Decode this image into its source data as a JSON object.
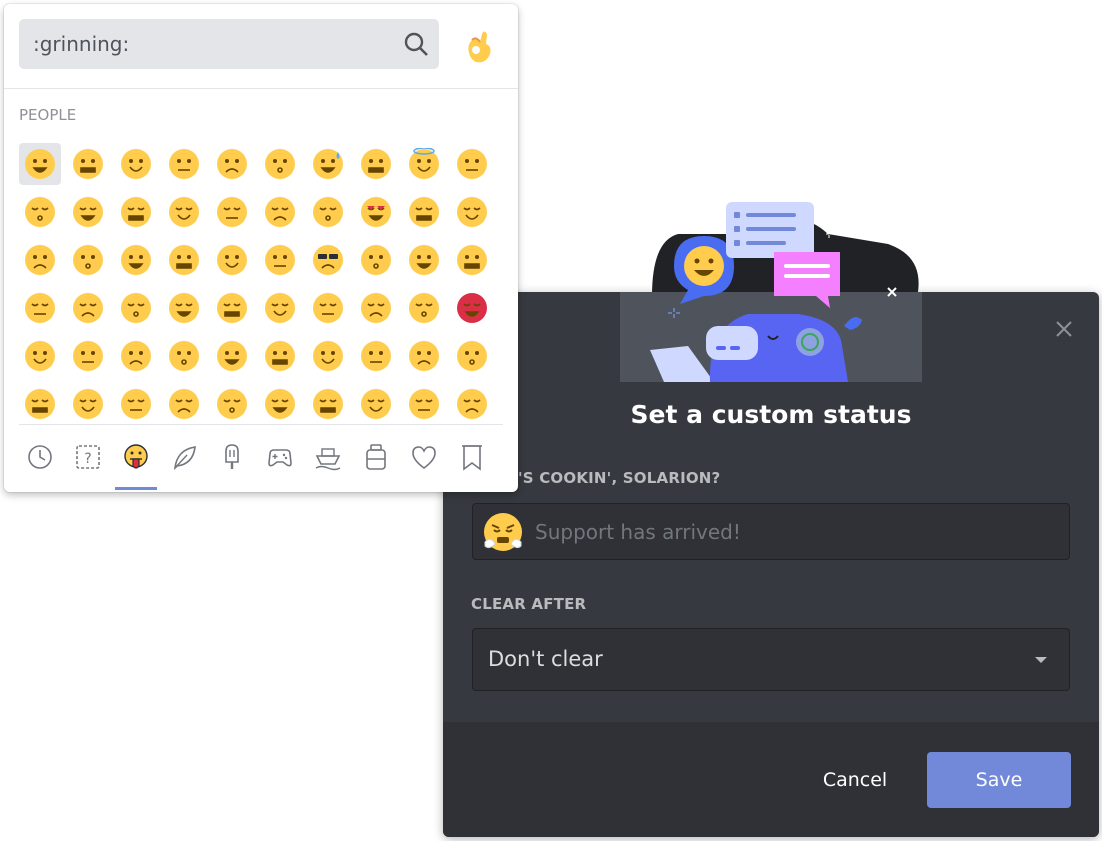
{
  "picker": {
    "search_value": ":grinning:",
    "category_title": "PEOPLE",
    "diversity_icon": "ok-hand-icon",
    "categories": [
      {
        "name": "recent",
        "icon": "clock-icon"
      },
      {
        "name": "custom",
        "icon": "unknown-box-icon"
      },
      {
        "name": "people",
        "icon": "tongue-face-icon",
        "active": true
      },
      {
        "name": "nature",
        "icon": "leaf-icon"
      },
      {
        "name": "food",
        "icon": "popsicle-icon"
      },
      {
        "name": "activities",
        "icon": "gamepad-icon"
      },
      {
        "name": "travel",
        "icon": "boat-icon"
      },
      {
        "name": "objects",
        "icon": "jar-icon"
      },
      {
        "name": "symbols",
        "icon": "heart-icon"
      },
      {
        "name": "flags",
        "icon": "flag-icon"
      }
    ],
    "emoji_rows": 6,
    "emoji_cols": 10,
    "selected_emoji": "grinning"
  },
  "modal": {
    "title": "Set a custom status",
    "status_label": "'S COOKIN', SOLARION?",
    "status_placeholder": "Support has arrived!",
    "status_emoji": "triumph-face-icon",
    "clear_label": "CLEAR AFTER",
    "clear_value": "Don't clear",
    "cancel_label": "Cancel",
    "save_label": "Save"
  },
  "colors": {
    "accent": "#7289da",
    "modal_bg": "#36393f",
    "emoji_yellow": "#ffcc4d",
    "angry_red": "#da2f47"
  }
}
